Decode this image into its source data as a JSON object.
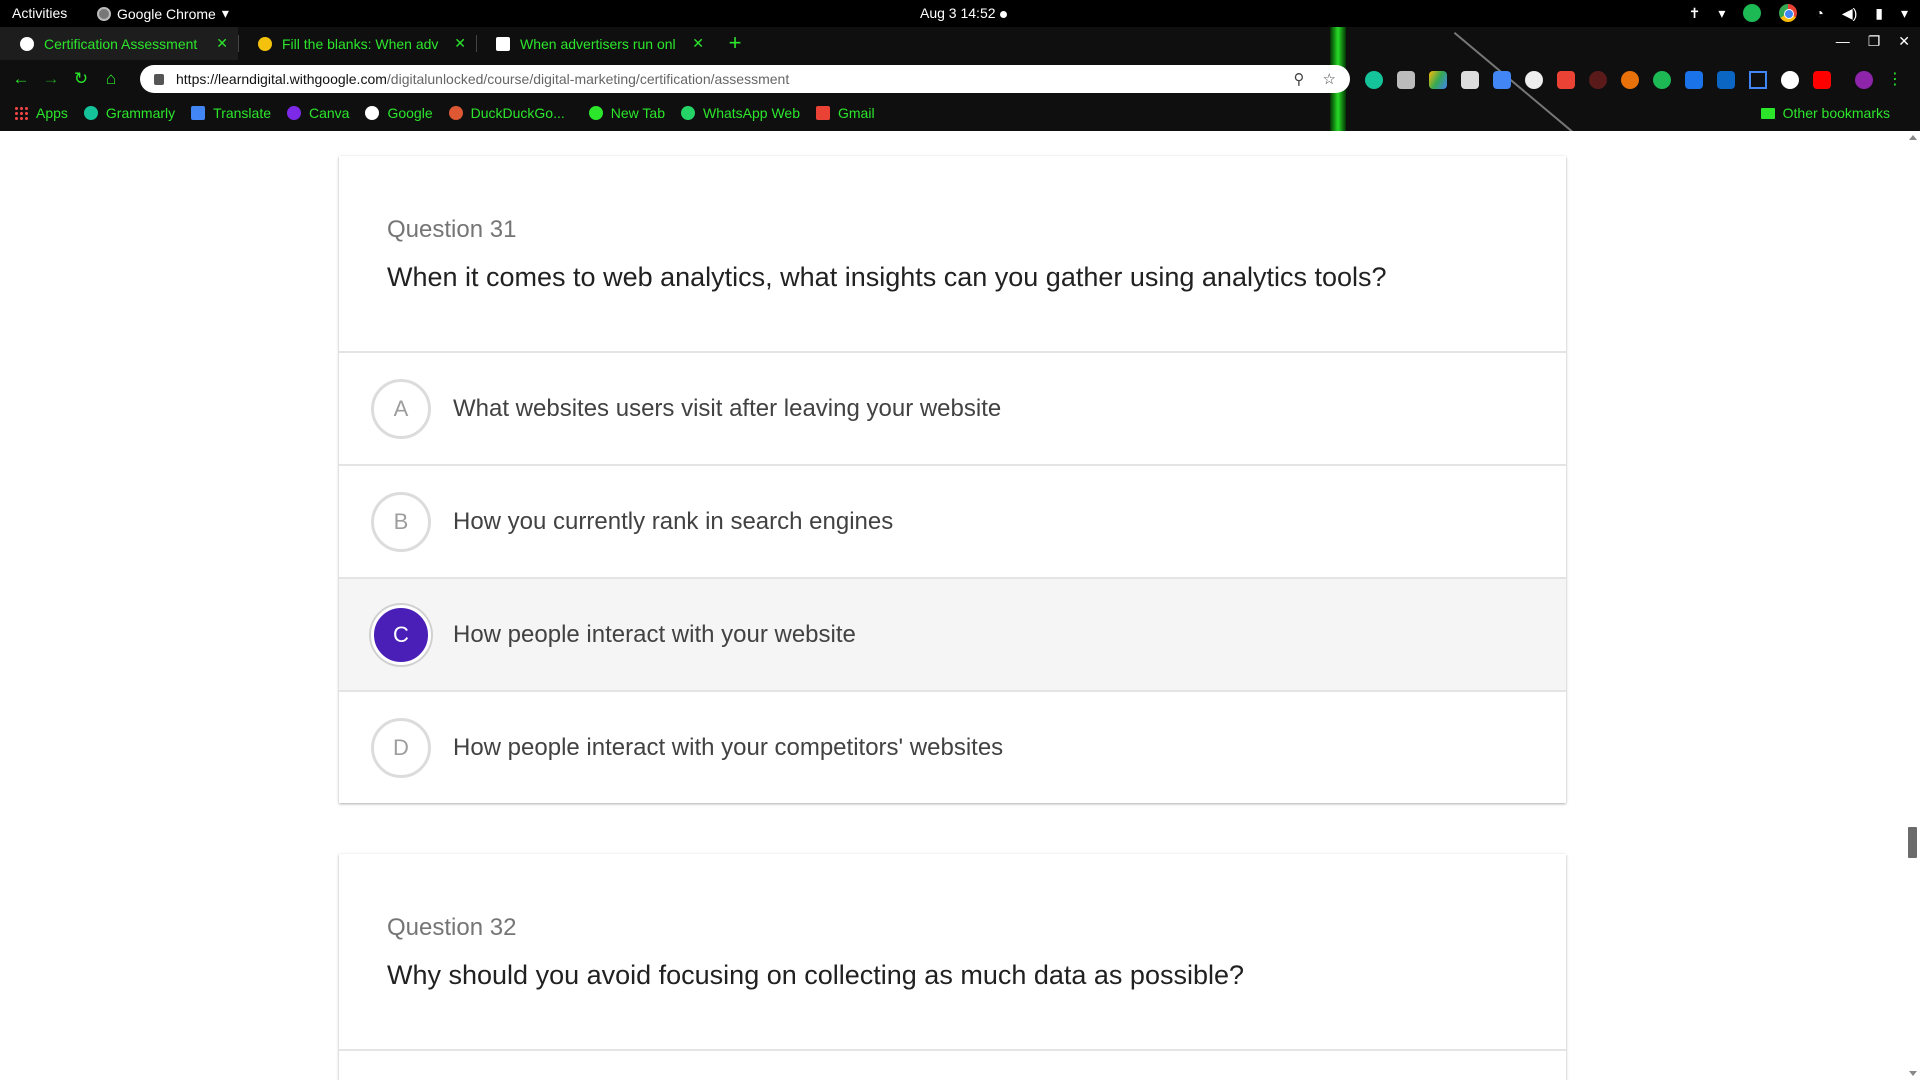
{
  "system": {
    "activities": "Activities",
    "app_name": "Google Chrome",
    "clock": "Aug 3  14:52"
  },
  "browser": {
    "tabs": [
      {
        "title": "Certification Assessment",
        "favicon_color": "#ffffff",
        "active": true
      },
      {
        "title": "Fill the blanks: When adv",
        "favicon_color": "#f4c20d",
        "active": false
      },
      {
        "title": "When advertisers run onl",
        "favicon_color": "#ffffff",
        "active": false
      }
    ],
    "url_host": "https://learndigital.withgoogle.com",
    "url_path": "/digitalunlocked/course/digital-marketing/certification/assessment",
    "bookmarks": [
      {
        "label": "Apps",
        "icon": "apps-grid-icon"
      },
      {
        "label": "Grammarly",
        "icon": "grammarly-icon",
        "color": "#15c39a"
      },
      {
        "label": "Translate",
        "icon": "translate-icon",
        "color": "#4285f4"
      },
      {
        "label": "Canva",
        "icon": "canva-icon",
        "color": "#7d2ae8"
      },
      {
        "label": "Google",
        "icon": "google-icon",
        "color": "#ffffff"
      },
      {
        "label": "DuckDuckGo...",
        "icon": "duckduckgo-icon",
        "color": "#de5833"
      },
      {
        "label": "New Tab",
        "icon": "new-tab-icon",
        "color": "#2ce62c"
      },
      {
        "label": "WhatsApp Web",
        "icon": "whatsapp-icon",
        "color": "#25d366"
      },
      {
        "label": "Gmail",
        "icon": "gmail-icon",
        "color": "#ea4335"
      }
    ],
    "other_bookmarks": "Other bookmarks",
    "accent_color": "#2ce62c"
  },
  "questions": [
    {
      "number_label": "Question 31",
      "text": "When it comes to web analytics, what insights can you gather using analytics tools?",
      "options": [
        {
          "letter": "A",
          "text": "What websites users visit after leaving your website",
          "selected": false
        },
        {
          "letter": "B",
          "text": "How you currently rank in search engines",
          "selected": false
        },
        {
          "letter": "C",
          "text": "How people interact with your website",
          "selected": true
        },
        {
          "letter": "D",
          "text": "How people interact with your competitors' websites",
          "selected": false
        }
      ]
    },
    {
      "number_label": "Question 32",
      "text": "Why should you avoid focusing on collecting as much data as possible?"
    }
  ],
  "selected_color": "#4a1fb8"
}
